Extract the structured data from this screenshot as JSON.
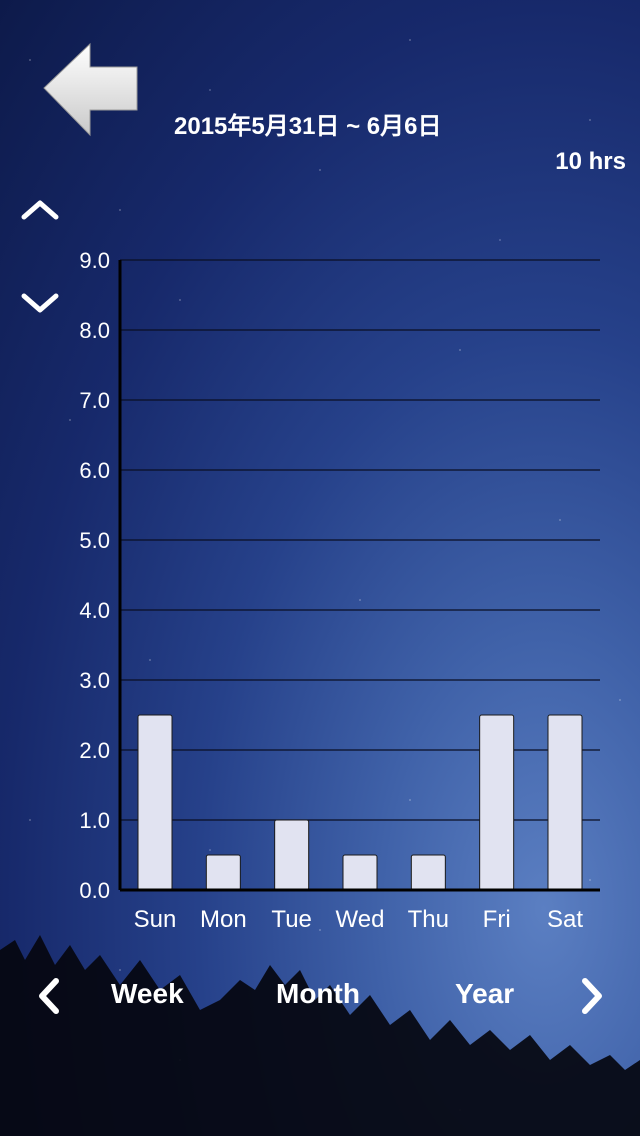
{
  "header": {
    "date_range": "2015年5月31日 ~ 6月6日",
    "total_hours": "10 hrs"
  },
  "period_tabs": {
    "week_label": "Week",
    "month_label": "Month",
    "year_label": "Year"
  },
  "icons": {
    "back": "back-arrow-icon",
    "up": "chevron-up-icon",
    "down": "chevron-down-icon",
    "prev": "chevron-left-icon",
    "next": "chevron-right-icon"
  },
  "colors": {
    "bar_fill": "#e1e3f1",
    "bar_stroke": "#1a1a1a",
    "grid": "#0a0f24",
    "axis": "#000000"
  },
  "chart_data": {
    "type": "bar",
    "categories": [
      "Sun",
      "Mon",
      "Tue",
      "Wed",
      "Thu",
      "Fri",
      "Sat"
    ],
    "values": [
      2.5,
      0.5,
      1.0,
      0.5,
      0.5,
      2.5,
      2.5
    ],
    "ylim": [
      0,
      9
    ],
    "yticks": [
      "0.0",
      "1.0",
      "2.0",
      "3.0",
      "4.0",
      "5.0",
      "6.0",
      "7.0",
      "8.0",
      "9.0"
    ],
    "grid": true,
    "title": "",
    "xlabel": "",
    "ylabel": ""
  }
}
